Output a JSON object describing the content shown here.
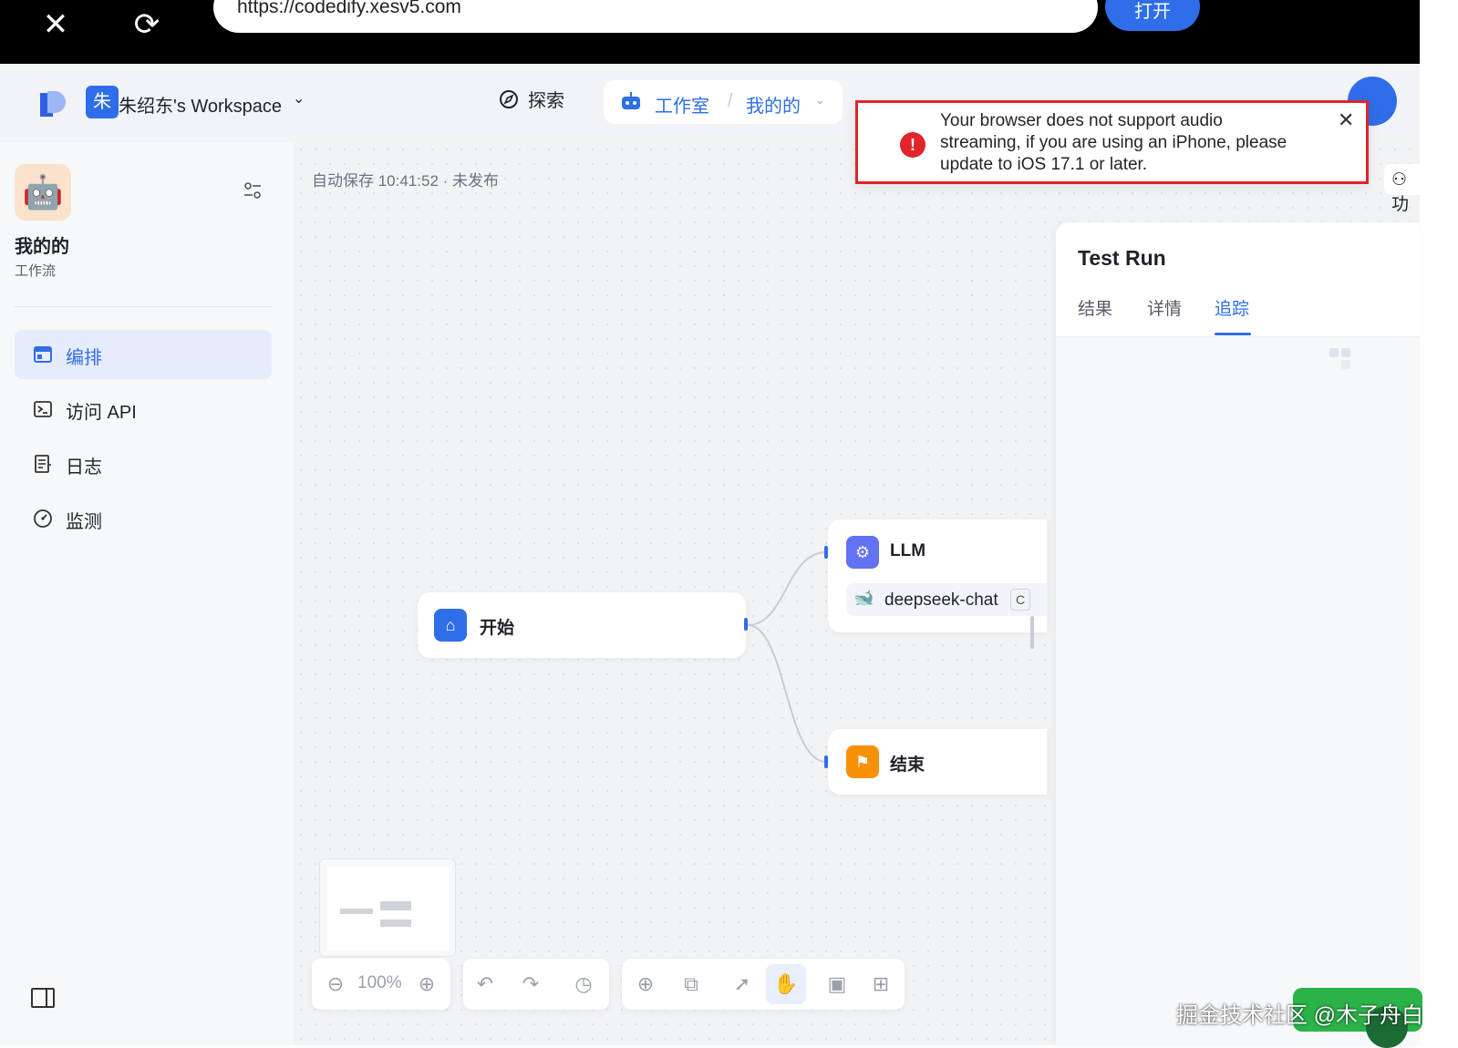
{
  "browser": {
    "url": "https://codedify.xesv5.com",
    "open_label": "打开"
  },
  "header": {
    "workspace_avatar": "朱",
    "workspace_name": "朱绍东's Workspace",
    "explore_label": "探索",
    "studio_label": "工作室",
    "separator": "/",
    "mine_label": "我的的"
  },
  "toast": {
    "message": "Your browser does not support audio streaming, if you are using an iPhone, please update to iOS 17.1 or later."
  },
  "sidebar": {
    "app_name": "我的的",
    "app_type": "工作流",
    "items": [
      {
        "label": "编排",
        "active": true,
        "icon": "layout-icon"
      },
      {
        "label": "访问 API",
        "active": false,
        "icon": "terminal-icon"
      },
      {
        "label": "日志",
        "active": false,
        "icon": "document-icon"
      },
      {
        "label": "监测",
        "active": false,
        "icon": "gauge-icon"
      }
    ]
  },
  "canvas": {
    "autosave": "自动保存 10:41:52 · 未发布",
    "zoom": "100%",
    "nodes": {
      "start": {
        "title": "开始"
      },
      "llm": {
        "title": "LLM",
        "model": "deepseek-chat",
        "model_tag": "C"
      },
      "end": {
        "title": "结束"
      }
    }
  },
  "test_run": {
    "title": "Test Run",
    "tabs": [
      {
        "label": "结果",
        "active": false
      },
      {
        "label": "详情",
        "active": false
      },
      {
        "label": "追踪",
        "active": true
      }
    ]
  },
  "side_tool_label": "功",
  "watermark": "掘金技术社区 @木子舟白",
  "colors": {
    "accent": "#2f6ee8",
    "error": "#e0242a",
    "llm_icon": "#6172f3",
    "end_icon": "#f79009"
  }
}
